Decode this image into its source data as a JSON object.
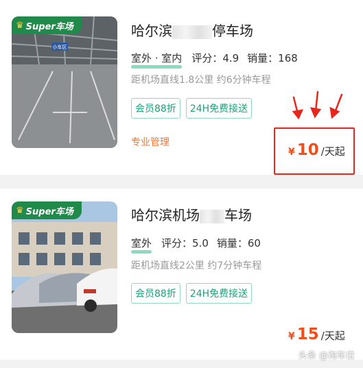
{
  "listings": [
    {
      "badge": {
        "crown_icon": "crown-icon",
        "text": "Super车场"
      },
      "image_sign": "小车区",
      "title_start": "哈尔滨",
      "title_end": "停车场",
      "parking_type": "室外 · 室内",
      "rating": "评分：4.9",
      "sales": "销量：168",
      "distance": "距机场直线1.8公里 约6分钟车程",
      "tags": [
        "会员88折",
        "24H免费接送"
      ],
      "management": "专业管理",
      "price": {
        "currency": "¥",
        "amount": "10",
        "unit": "/天起"
      }
    },
    {
      "badge": {
        "crown_icon": "crown-icon",
        "text": "Super车场"
      },
      "title_start": "哈尔滨机场",
      "title_end": "车场",
      "parking_type": "室外",
      "rating": "评分：5.0",
      "sales": "销量：60",
      "distance": "距机场直线2公里 约7分钟车程",
      "tags": [
        "会员88折",
        "24H免费接送"
      ],
      "price": {
        "currency": "¥",
        "amount": "15",
        "unit": "/天起"
      }
    }
  ],
  "annotation": {
    "color": "#e8261c",
    "arrow_icon": "red-arrow-icon"
  },
  "watermark": "头条 @淘车位",
  "colors": {
    "brand_green": "#1f8a4a",
    "tag_green": "#1aa37a",
    "price_orange": "#f04f1c"
  }
}
